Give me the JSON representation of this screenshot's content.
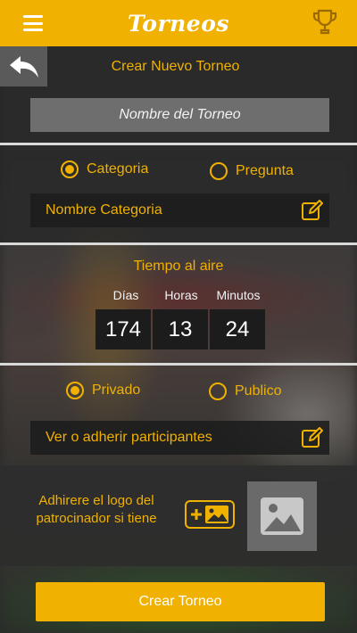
{
  "header": {
    "app_title": "Torneos",
    "menu_icon": "hamburger-menu-icon",
    "trophy_icon": "trophy-icon",
    "color": "#f0b100"
  },
  "nav": {
    "back_icon": "back-arrow-icon",
    "page_title": "Crear Nuevo Torneo"
  },
  "form": {
    "name_placeholder": "Nombre del Torneo",
    "type_options": [
      {
        "label": "Categoria",
        "selected": true
      },
      {
        "label": "Pregunta",
        "selected": false
      }
    ],
    "category_field": {
      "label": "Nombre Categoria",
      "icon": "edit-icon"
    },
    "air_time": {
      "title": "Tiempo al aire",
      "units": [
        {
          "label": "Días",
          "value": "174"
        },
        {
          "label": "Horas",
          "value": "13"
        },
        {
          "label": "Minutos",
          "value": "24"
        }
      ]
    },
    "privacy_options": [
      {
        "label": "Privado",
        "selected": true
      },
      {
        "label": "Publico",
        "selected": false
      }
    ],
    "participants_field": {
      "label": "Ver o adherir participantes",
      "icon": "edit-icon"
    },
    "sponsor": {
      "text": "Adhirere el logo del patrocinador si tiene",
      "add_icon": "add-image-icon",
      "placeholder_icon": "image-placeholder-icon"
    },
    "submit_label": "Crear Torneo"
  },
  "colors": {
    "accent": "#f0b100",
    "panel": "#262626",
    "input_gray": "#6e6e6e"
  }
}
